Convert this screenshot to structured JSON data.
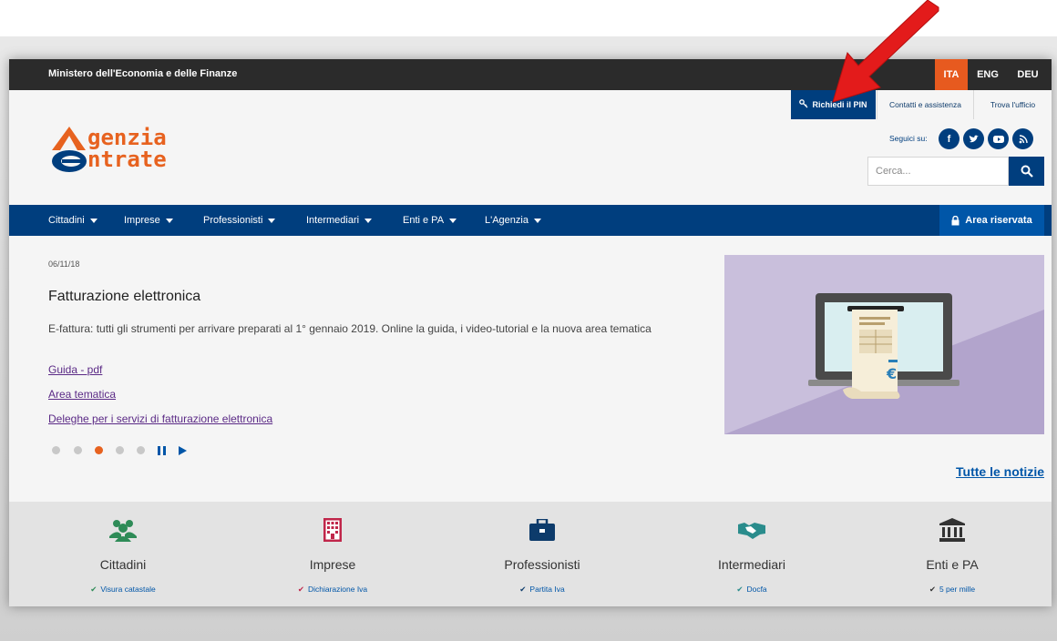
{
  "topbar": {
    "ministry": "Ministero dell'Economia e delle Finanze",
    "languages": [
      "ITA",
      "ENG",
      "DEU"
    ],
    "active_language": "ITA"
  },
  "header": {
    "pin_button": "Richiedi il PIN",
    "links": [
      "Contatti e assistenza",
      "Trova l'ufficio"
    ],
    "logo": {
      "line1": "genzia",
      "line2": "ntrate"
    },
    "social_label": "Seguici su:",
    "social_icons": [
      "facebook-icon",
      "twitter-icon",
      "youtube-icon",
      "rss-icon"
    ],
    "search_placeholder": "Cerca..."
  },
  "nav": {
    "items": [
      "Cittadini",
      "Imprese",
      "Professionisti",
      "Intermediari",
      "Enti e PA",
      "L'Agenzia"
    ],
    "area_riservata": "Area riservata"
  },
  "news": {
    "date": "06/11/18",
    "title": "Fatturazione elettronica",
    "abstract": "E-fattura: tutti gli strumenti per arrivare preparati al 1° gennaio 2019. Online la guida, i video-tutorial e la nuova area tematica",
    "links": [
      "Guida - pdf",
      "Area tematica",
      "Deleghe per i servizi di fatturazione elettronica"
    ],
    "slides_total": 5,
    "slide_active": 3,
    "all_news": "Tutte le notizie",
    "image_symbol": "€"
  },
  "categories": [
    {
      "label": "Cittadini",
      "sub": "Visura catastale",
      "icon": "users-icon",
      "color": "#2e8b57"
    },
    {
      "label": "Imprese",
      "sub": "Dichiarazione Iva",
      "icon": "building-icon",
      "color": "#c0264a"
    },
    {
      "label": "Professionisti",
      "sub": "Partita Iva",
      "icon": "briefcase-icon",
      "color": "#0d3b6b"
    },
    {
      "label": "Intermediari",
      "sub": "Docfa",
      "icon": "handshake-icon",
      "color": "#2a8c8c"
    },
    {
      "label": "Enti e PA",
      "sub": "5 per mille",
      "icon": "bank-icon",
      "color": "#333333"
    }
  ],
  "colors": {
    "brand_blue": "#003e7e",
    "brand_orange": "#e7621f",
    "link_purple": "#5b2a86",
    "topbar": "#2b2b2b"
  }
}
